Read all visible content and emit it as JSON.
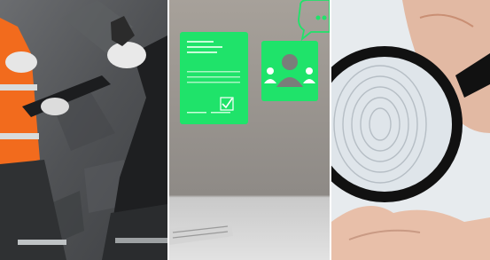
{
  "collage": {
    "panels": [
      {
        "subject": "workers-with-clipboard-and-rock"
      },
      {
        "subject": "document-and-user-profile-hologram"
      },
      {
        "subject": "magnifying-glass-over-fingerprint"
      }
    ]
  },
  "colors": {
    "safety_orange": "#f26b1d",
    "hologram_green": "#1fe36a",
    "rock_gray": "#55575a",
    "skin": "#e8b9a0",
    "lens_rim": "#111111"
  },
  "icons": [
    "checkmark-icon",
    "user-group-icon",
    "chat-bubble-icon"
  ]
}
